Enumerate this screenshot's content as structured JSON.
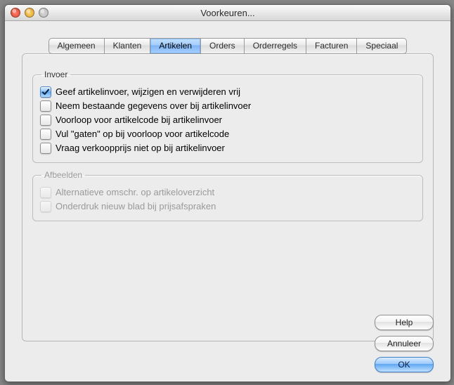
{
  "window": {
    "title": "Voorkeuren..."
  },
  "tabs": [
    {
      "label": "Algemeen",
      "active": false
    },
    {
      "label": "Klanten",
      "active": false
    },
    {
      "label": "Artikelen",
      "active": true
    },
    {
      "label": "Orders",
      "active": false
    },
    {
      "label": "Orderregels",
      "active": false
    },
    {
      "label": "Facturen",
      "active": false
    },
    {
      "label": "Speciaal",
      "active": false
    }
  ],
  "groups": {
    "invoer": {
      "legend": "Invoer",
      "options": [
        {
          "label": "Geef artikelinvoer, wijzigen en verwijderen vrij",
          "checked": true
        },
        {
          "label": "Neem bestaande gegevens over bij artikelinvoer",
          "checked": false
        },
        {
          "label": "Voorloop voor artikelcode bij artikelinvoer",
          "checked": false
        },
        {
          "label": "Vul \"gaten\" op bij voorloop voor artikelcode",
          "checked": false
        },
        {
          "label": "Vraag verkoopprijs niet op bij artikelinvoer",
          "checked": false
        }
      ]
    },
    "afbeelden": {
      "legend": "Afbeelden",
      "disabled": true,
      "options": [
        {
          "label": "Alternatieve omschr. op artikeloverzicht",
          "checked": false
        },
        {
          "label": "Onderdruk nieuw blad bij prijsafspraken",
          "checked": false
        }
      ]
    }
  },
  "buttons": {
    "help": "Help",
    "cancel": "Annuleer",
    "ok": "OK"
  }
}
